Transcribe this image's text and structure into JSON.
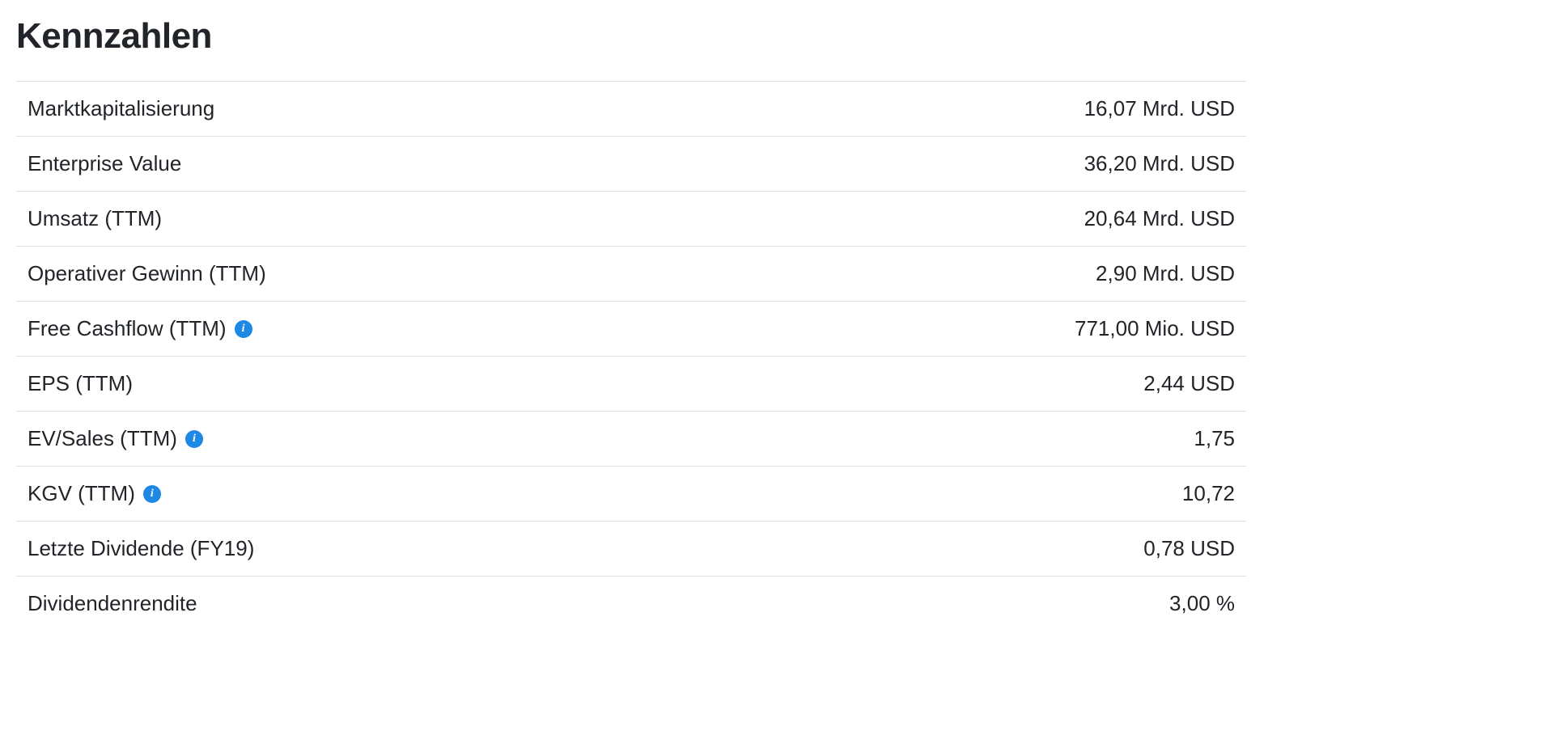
{
  "section": {
    "title": "Kennzahlen"
  },
  "metrics": [
    {
      "label": "Marktkapitalisierung",
      "value": "16,07 Mrd. USD",
      "info": false
    },
    {
      "label": "Enterprise Value",
      "value": "36,20 Mrd. USD",
      "info": false
    },
    {
      "label": "Umsatz (TTM)",
      "value": "20,64 Mrd. USD",
      "info": false
    },
    {
      "label": "Operativer Gewinn (TTM)",
      "value": "2,90 Mrd. USD",
      "info": false
    },
    {
      "label": "Free Cashflow (TTM)",
      "value": "771,00 Mio. USD",
      "info": true
    },
    {
      "label": "EPS (TTM)",
      "value": "2,44 USD",
      "info": false
    },
    {
      "label": "EV/Sales (TTM)",
      "value": "1,75",
      "info": true
    },
    {
      "label": "KGV (TTM)",
      "value": "10,72",
      "info": true
    },
    {
      "label": "Letzte Dividende (FY19)",
      "value": "0,78 USD",
      "info": false
    },
    {
      "label": "Dividendenrendite",
      "value": "3,00 %",
      "info": false
    }
  ]
}
